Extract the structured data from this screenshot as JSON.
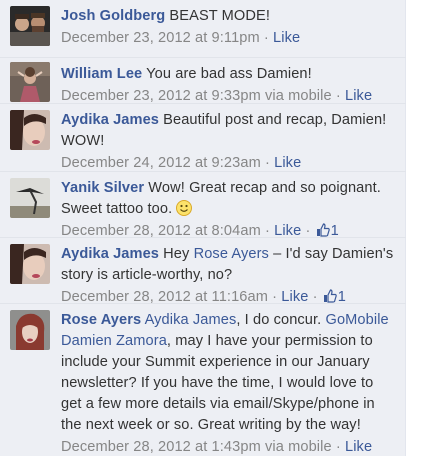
{
  "comments": [
    {
      "name": "Josh Goldberg",
      "text": " BEAST MODE!",
      "date": "December 23, 2012 at 9:11pm",
      "sep": " · ",
      "like": "Like"
    },
    {
      "name": "William Lee",
      "text": " You are bad ass Damien!",
      "date": "December 23, 2012 at 9:33pm via mobile",
      "sep": " · ",
      "like": "Like"
    },
    {
      "name": "Aydika James",
      "text": " Beautiful post and recap, Damien! WOW!",
      "date": "December 24, 2012 at 9:23am",
      "sep": " · ",
      "like": "Like"
    },
    {
      "name": "Yanik Silver",
      "text": " Wow! Great recap and so poignant. Sweet tattoo too. ",
      "date": "December 28, 2012 at 8:04am",
      "sep": " · ",
      "like": "Like",
      "sep2": " · ",
      "like_count": "1"
    },
    {
      "name": "Aydika James",
      "text_pre": " Hey ",
      "mention": "Rose Ayers",
      "text_post": " – I'd say Damien's story is article-worthy, no?",
      "date": "December 28, 2012 at 11:16am",
      "sep": " · ",
      "like": "Like",
      "sep2": " · ",
      "like_count": "1"
    },
    {
      "name": "Rose Ayers",
      "mention1": "Aydika James",
      "text_mid": ", I do concur. ",
      "mention2": "GoMobile Damien Zamora",
      "text_post": ", may I have your permission to include your Summit experience in our January newsletter? If you have the time, I would love to get a few more details via email/Skype/phone in the next week or so. Great writing by the way!",
      "date": "December 28, 2012 at 1:43pm via mobile",
      "sep": " · ",
      "like": "Like"
    }
  ],
  "colors": {
    "background": "#edeff4",
    "link": "#3b5998",
    "meta": "#868686",
    "text": "#333333"
  }
}
